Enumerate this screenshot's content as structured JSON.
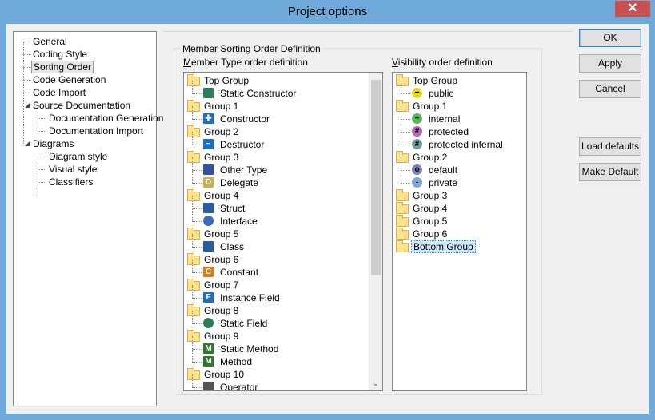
{
  "window": {
    "title": "Project options",
    "close_glyph": "✕"
  },
  "nav": {
    "items": [
      {
        "label": "General",
        "indent": 0,
        "selected": false
      },
      {
        "label": "Coding Style",
        "indent": 0,
        "selected": false
      },
      {
        "label": "Sorting Order",
        "indent": 0,
        "selected": true
      },
      {
        "label": "Code Generation",
        "indent": 0,
        "selected": false
      },
      {
        "label": "Code Import",
        "indent": 0,
        "selected": false
      },
      {
        "label": "Source Documentation",
        "indent": 0,
        "selected": false,
        "expanded": true
      },
      {
        "label": "Documentation Generation",
        "indent": 1,
        "selected": false
      },
      {
        "label": "Documentation Import",
        "indent": 1,
        "selected": false
      },
      {
        "label": "Diagrams",
        "indent": 0,
        "selected": false,
        "expanded": true
      },
      {
        "label": "Diagram style",
        "indent": 1,
        "selected": false
      },
      {
        "label": "Visual style",
        "indent": 1,
        "selected": false
      },
      {
        "label": "Classifiers",
        "indent": 1,
        "selected": false
      }
    ]
  },
  "section": {
    "group_label": "Member Sorting Order Definition",
    "member_label": "Member Type order definition",
    "visibility_label": "Visibility order definition"
  },
  "member_tree": [
    {
      "label": "Top Group",
      "type": "folder"
    },
    {
      "label": "Static Constructor",
      "type": "item",
      "icon": "static-constructor-icon",
      "color": "#2f7f5f"
    },
    {
      "label": "Group 1",
      "type": "folder"
    },
    {
      "label": "Constructor",
      "type": "item",
      "icon": "constructor-icon",
      "color": "#1a6fc4",
      "glyph": "✚"
    },
    {
      "label": "Group 2",
      "type": "folder"
    },
    {
      "label": "Destructor",
      "type": "item",
      "icon": "destructor-icon",
      "color": "#1a6fc4",
      "glyph": "~"
    },
    {
      "label": "Group 3",
      "type": "folder"
    },
    {
      "label": "Other Type",
      "type": "item",
      "icon": "other-type-icon",
      "color": "#3050a0"
    },
    {
      "label": "Delegate",
      "type": "item",
      "icon": "delegate-icon",
      "color": "#c9b24a",
      "glyph": "D"
    },
    {
      "label": "Group 4",
      "type": "folder"
    },
    {
      "label": "Struct",
      "type": "item",
      "icon": "struct-icon",
      "color": "#2a5aa0"
    },
    {
      "label": "Interface",
      "type": "item",
      "icon": "interface-icon",
      "color": "#3a6ac0"
    },
    {
      "label": "Group 5",
      "type": "folder"
    },
    {
      "label": "Class",
      "type": "item",
      "icon": "class-icon",
      "color": "#2a5aa0"
    },
    {
      "label": "Group 6",
      "type": "folder"
    },
    {
      "label": "Constant",
      "type": "item",
      "icon": "constant-icon",
      "color": "#e07a1a",
      "glyph": "C"
    },
    {
      "label": "Group 7",
      "type": "folder"
    },
    {
      "label": "Instance Field",
      "type": "item",
      "icon": "instance-field-icon",
      "color": "#1a6fc4",
      "glyph": "F"
    },
    {
      "label": "Group 8",
      "type": "folder"
    },
    {
      "label": "Static Field",
      "type": "item",
      "icon": "static-field-icon",
      "color": "#2a7f4f"
    },
    {
      "label": "Group 9",
      "type": "folder"
    },
    {
      "label": "Static Method",
      "type": "item",
      "icon": "static-method-icon",
      "color": "#2a7a2a",
      "glyph": "M"
    },
    {
      "label": "Method",
      "type": "item",
      "icon": "method-icon",
      "color": "#2a7a2a",
      "glyph": "M"
    },
    {
      "label": "Group 10",
      "type": "folder"
    },
    {
      "label": "Operator",
      "type": "item",
      "icon": "operator-icon",
      "color": "#555555"
    }
  ],
  "visibility_tree": [
    {
      "label": "Top Group",
      "type": "folder"
    },
    {
      "label": "public",
      "type": "item",
      "icon": "public-icon",
      "color": "#e8d820",
      "glyph": "+"
    },
    {
      "label": "Group 1",
      "type": "folder"
    },
    {
      "label": "internal",
      "type": "item",
      "icon": "internal-icon",
      "color": "#5bb85b",
      "glyph": "~"
    },
    {
      "label": "protected",
      "type": "item",
      "icon": "protected-icon",
      "color": "#c060c0",
      "glyph": "#"
    },
    {
      "label": "protected internal",
      "type": "item",
      "icon": "protected-internal-icon",
      "color": "#6aa0a0",
      "glyph": "#"
    },
    {
      "label": "Group 2",
      "type": "folder"
    },
    {
      "label": "default",
      "type": "item",
      "icon": "default-icon",
      "color": "#8080c0",
      "glyph": "o"
    },
    {
      "label": "private",
      "type": "item",
      "icon": "private-icon",
      "color": "#7aa8d8",
      "glyph": "-"
    },
    {
      "label": "Group 3",
      "type": "folder"
    },
    {
      "label": "Group 4",
      "type": "folder"
    },
    {
      "label": "Group 5",
      "type": "folder"
    },
    {
      "label": "Group 6",
      "type": "folder"
    },
    {
      "label": "Bottom Group",
      "type": "folder",
      "selected": true
    }
  ],
  "buttons": {
    "ok": "OK",
    "apply": "Apply",
    "cancel": "Cancel",
    "load_defaults": "Load defaults",
    "make_default": "Make Default"
  },
  "scroll_glyph": "⌄"
}
